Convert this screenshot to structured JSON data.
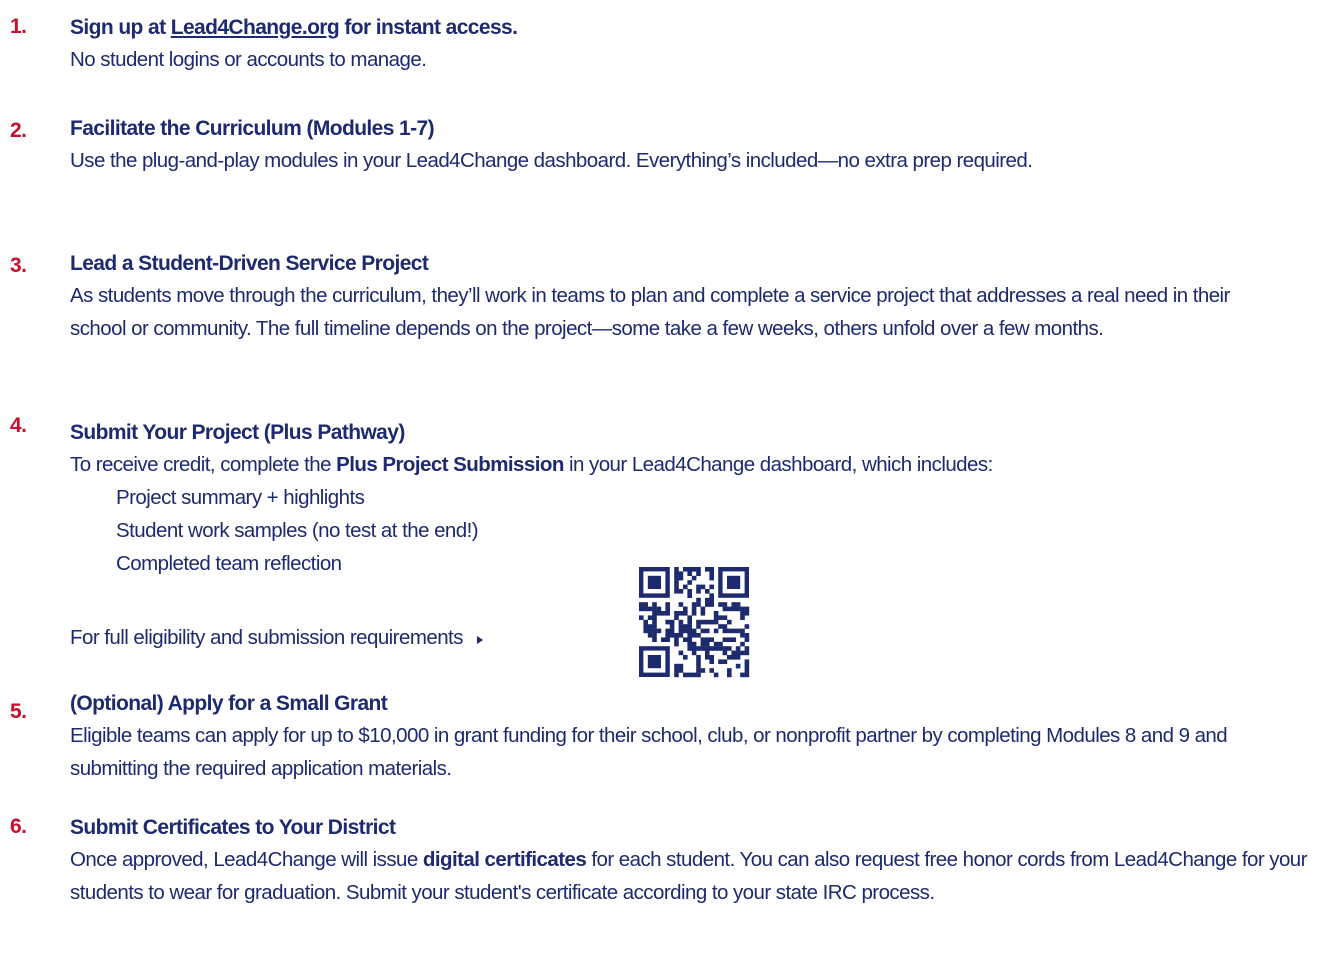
{
  "steps": [
    {
      "num": "1.",
      "heading_pre": "Sign up at ",
      "heading_link": "Lead4Change.org",
      "heading_post": " for instant access.",
      "body": "No student logins or accounts to manage."
    },
    {
      "num": "2.",
      "heading": "Facilitate the Curriculum (Modules 1-7)",
      "body": "Use the plug-and-play modules in your Lead4Change dashboard. Everything’s included—no extra prep required."
    },
    {
      "num": "3.",
      "heading": "Lead a Student-Driven Service Project",
      "body": "As students move through the curriculum, they’ll work in teams to plan and complete a service project that addresses a real need in their school or community. The full timeline depends on the project—some take a few weeks, others unfold over a few months."
    },
    {
      "num": "4.",
      "heading": "Submit Your Project (Plus Pathway)",
      "body_pre": "To receive credit, complete the ",
      "body_bold": "Plus Project Submission",
      "body_post": " in your Lead4Change dashboard, which includes:",
      "items": [
        "Project summary + highlights",
        "Student work samples (no test at the end!)",
        "Completed team reflection"
      ],
      "eligibility": "For full eligibility and submission requirements"
    },
    {
      "num": "5.",
      "heading": "(Optional) Apply for a Small Grant",
      "body": "Eligible teams can apply for up to $10,000 in grant funding for their school, club, or nonprofit partner by completing Modules 8 and 9 and submitting the required application materials."
    },
    {
      "num": "6.",
      "heading": "Submit Certificates to Your District",
      "body_pre": "Once approved, Lead4Change will issue ",
      "body_bold": "digital certificates",
      "body_post": " for each student. You can also request free honor cords from Lead4Change for your students to wear for graduation. Submit your student's certificate according to your state IRC process."
    }
  ],
  "icons": {
    "arrow": "caret-right-icon",
    "qr": "qr-code-icon"
  },
  "colors": {
    "number": "#c8102e",
    "text": "#1d2a6e"
  }
}
